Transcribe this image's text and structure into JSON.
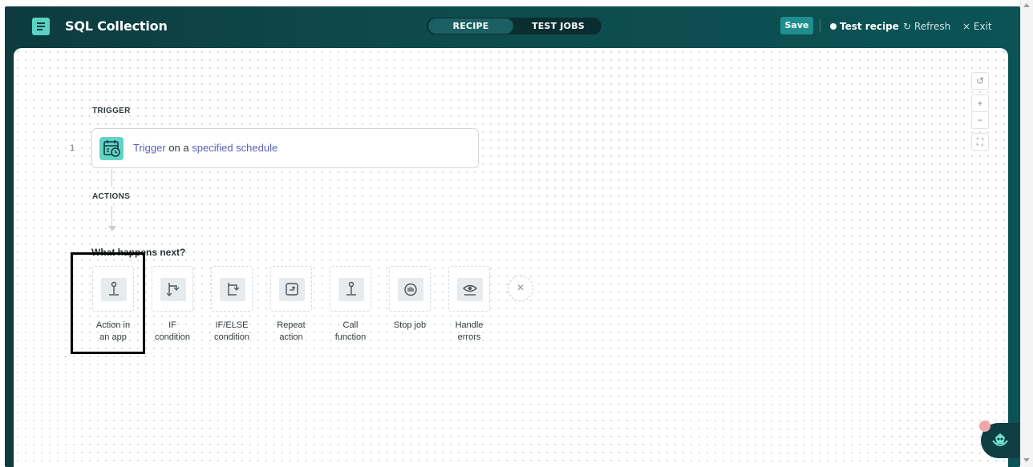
{
  "header": {
    "title": "SQL Collection",
    "tabs": [
      {
        "label": "RECIPE",
        "active": true
      },
      {
        "label": "TEST JOBS",
        "active": false
      }
    ],
    "save_label": "Save",
    "test_recipe_label": "Test recipe",
    "refresh_label": "Refresh",
    "exit_label": "Exit",
    "refresh_glyph": "↻",
    "exit_glyph": "×"
  },
  "recipe": {
    "trigger_section_label": "TRIGGER",
    "step_number": "1",
    "trigger_part1": "Trigger",
    "trigger_part2": " on a ",
    "trigger_part3": "specified schedule",
    "actions_section_label": "ACTIONS",
    "next_prompt": "What happens next?",
    "options": [
      {
        "line1": "Action in",
        "line2": "an app",
        "icon": "action-in-app-icon"
      },
      {
        "line1": "IF",
        "line2": "condition",
        "icon": "if-condition-icon"
      },
      {
        "line1": "IF/ELSE",
        "line2": "condition",
        "icon": "if-else-condition-icon"
      },
      {
        "line1": "Repeat",
        "line2": "action",
        "icon": "repeat-action-icon"
      },
      {
        "line1": "Call",
        "line2": "function",
        "icon": "call-function-icon"
      },
      {
        "line1": "Stop job",
        "line2": "",
        "icon": "stop-job-icon"
      },
      {
        "line1": "Handle",
        "line2": "errors",
        "icon": "handle-errors-icon"
      }
    ],
    "close_glyph": "×"
  },
  "zoom": {
    "reset_glyph": "↺",
    "zoom_in_glyph": "+",
    "zoom_out_glyph": "−",
    "fit_glyph": "⛶"
  },
  "colors": {
    "header_bg": "#0d3b3e",
    "accent": "#1f8e8f",
    "trigger_icon": "#63d3c6",
    "link": "#5a5fbf"
  }
}
